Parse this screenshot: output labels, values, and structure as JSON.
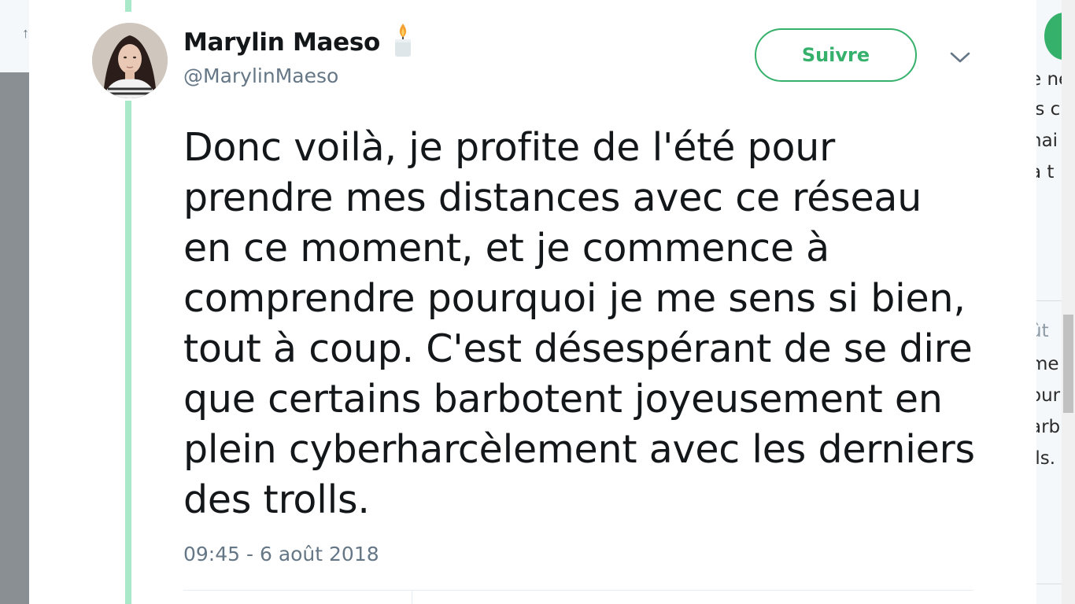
{
  "tweet": {
    "author": {
      "display_name": "Marylin Maeso",
      "username": "@MarylinMaeso",
      "name_emoji": "candle-icon"
    },
    "follow_label": "Suivre",
    "menu_icon": "chevron-down-icon",
    "text": "Donc voilà, je profite de l'été pour prendre mes distances avec ce réseau en ce moment, et je commence à comprendre pourquoi je me sens si bien, tout à coup. C'est désespérant de se dire que certains barbotent joyeusement en plein cyberharcèlement avec les derniers des trolls.",
    "timestamp": "09:45 - 6 août 2018"
  },
  "background_fragments": [
    "e ne",
    "is c",
    "nai",
    "à t",
    "ût",
    "me",
    "our",
    "arb",
    "lls."
  ],
  "colors": {
    "accent": "#35b16b",
    "thread_line": "#a9e9c9",
    "text": "#14171a",
    "muted": "#657786"
  }
}
